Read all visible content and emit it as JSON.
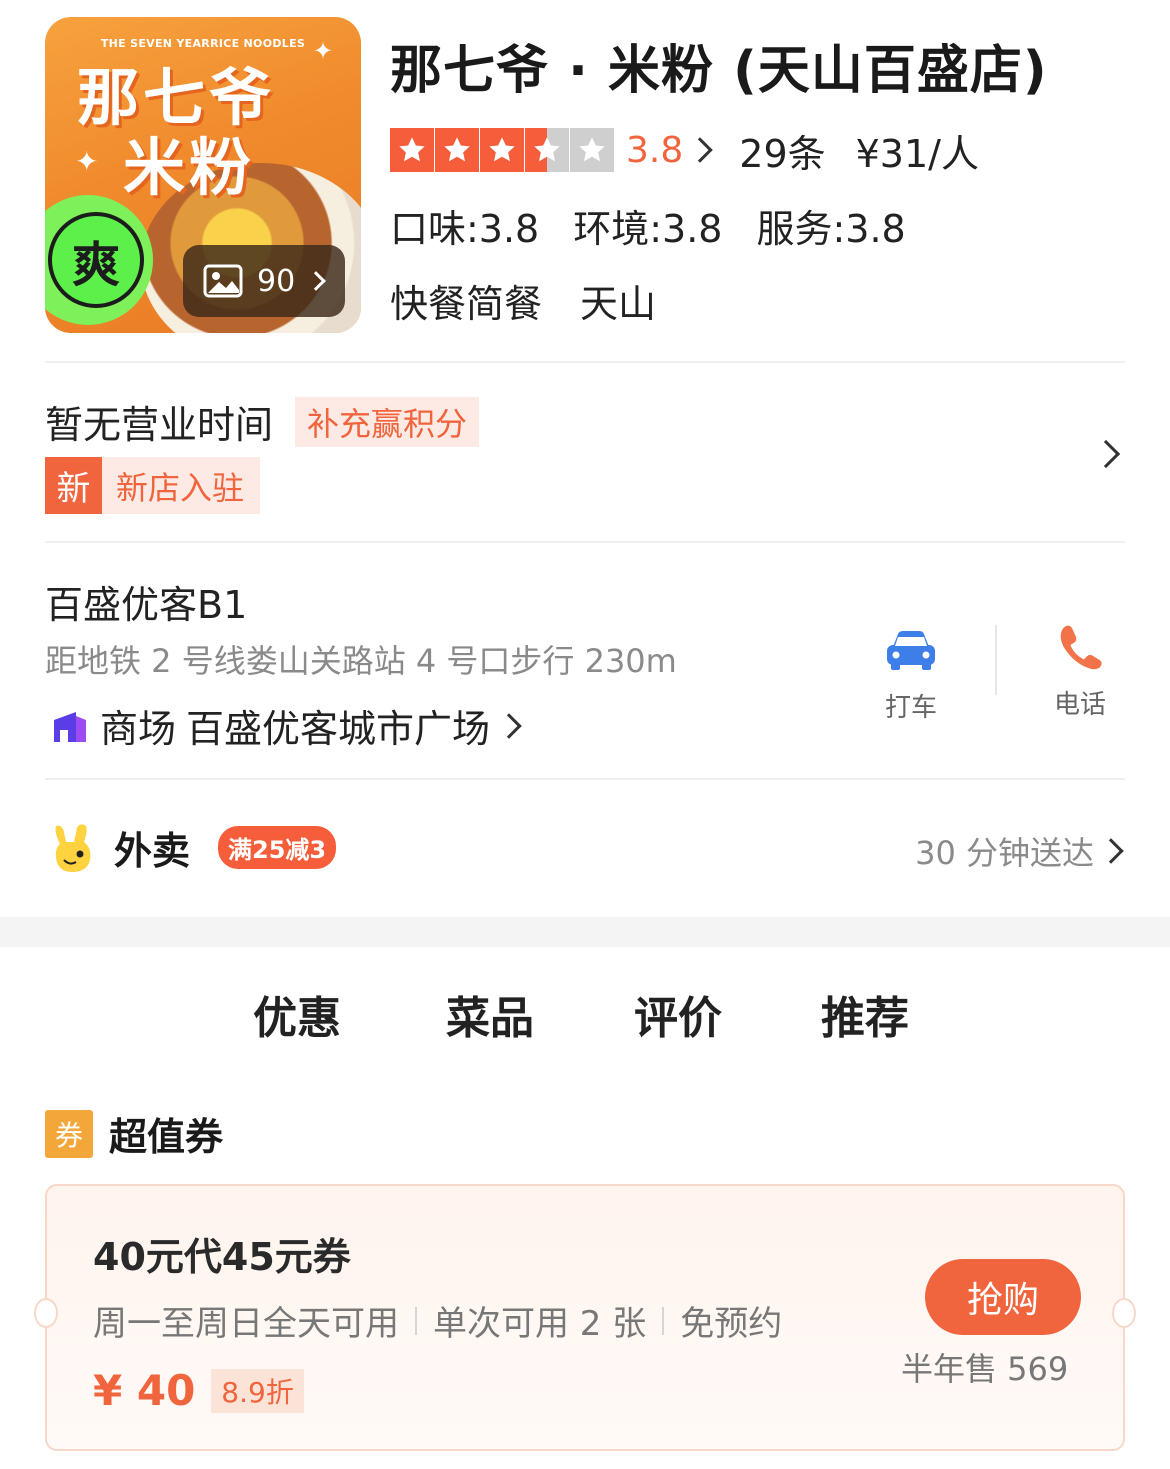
{
  "store": {
    "cover_en": "THE SEVEN YEARRICE NOODLES",
    "cover_line1": "那七爷",
    "cover_line2": "米粉",
    "cover_badge": "爽",
    "gallery_count": "90",
    "name": "那七爷 · 米粉 (天山百盛店)",
    "rating": "3.8",
    "rating_stars": 3.5,
    "reviews": "29条",
    "price": "¥31/人",
    "sub_scores": [
      "口味:3.8",
      "环境:3.8",
      "服务:3.8"
    ],
    "tags": [
      "快餐简餐",
      "天山"
    ]
  },
  "hours": {
    "text": "暂无营业时间",
    "pill": "补充赢积分",
    "new_icon": "新",
    "new_text": "新店入驻"
  },
  "address": {
    "line": "百盛优客B1",
    "metro": "距地铁 2 号线娄山关路站 4 号口步行 230m",
    "mall_prefix": "商场",
    "mall_name": "百盛优客城市广场",
    "taxi_label": "打车",
    "phone_label": "电话"
  },
  "delivery": {
    "label": "外卖",
    "promo": "满25减3",
    "time": "30 分钟送达"
  },
  "tabs": [
    "优惠",
    "菜品",
    "评价",
    "推荐"
  ],
  "coupons": {
    "section_icon": "券",
    "section_title": "超值券",
    "name": "40元代45元券",
    "desc": [
      "周一至周日全天可用",
      "单次可用 2 张",
      "免预约"
    ],
    "price": "¥ 40",
    "discount": "8.9折",
    "buy_label": "抢购",
    "sold": "半年售 569"
  },
  "colors": {
    "accent": "#f0653d",
    "star_on": "#f55d3b",
    "star_off": "#cfcfcf",
    "muted": "#8a8a8a"
  }
}
